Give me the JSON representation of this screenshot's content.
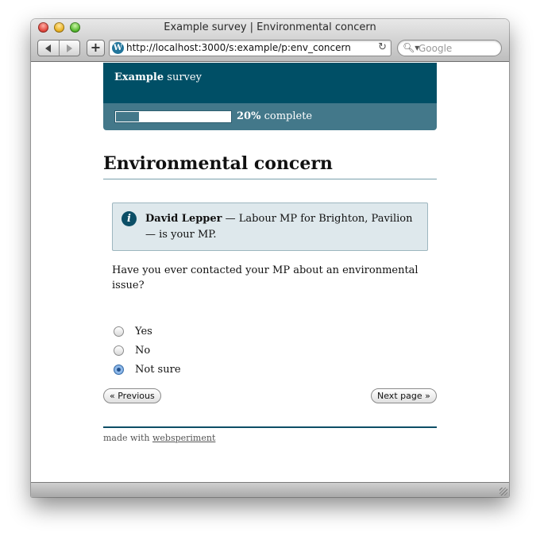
{
  "window": {
    "title": "Example survey | Environmental concern"
  },
  "toolbar": {
    "url": "http://localhost:3000/s:example/p:env_concern",
    "search_placeholder": "Google",
    "site_icon": "wordpress-icon",
    "reload_icon": "reload-icon"
  },
  "header": {
    "brand_bold": "Example",
    "brand_rest": " survey"
  },
  "progress": {
    "percent": 20,
    "percent_label": "20%",
    "suffix": " complete"
  },
  "page": {
    "title": "Environmental concern"
  },
  "info": {
    "name": "David Lepper",
    "rest": " — Labour MP for Brighton, Pavilion — is your MP."
  },
  "question": {
    "text": "Have you ever contacted your MP about an environmental issue?",
    "options": [
      {
        "label": "Yes",
        "checked": false
      },
      {
        "label": "No",
        "checked": false
      },
      {
        "label": "Not sure",
        "checked": true
      }
    ]
  },
  "nav": {
    "previous": "« Previous",
    "next": "Next page »"
  },
  "footer": {
    "prefix": "made with ",
    "link": "websperiment"
  },
  "colors": {
    "header": "#004f66",
    "progress_band": "#43788a"
  }
}
